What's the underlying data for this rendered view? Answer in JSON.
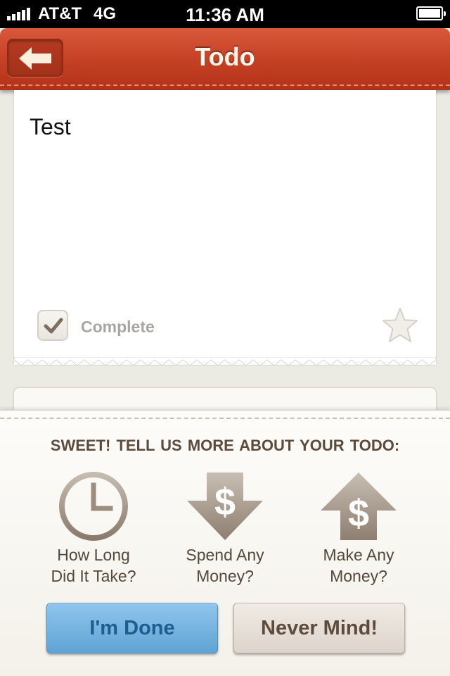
{
  "status_bar": {
    "carrier": "AT&T",
    "network": "4G",
    "time": "11:36 AM",
    "signal_icon": "signal-bars-icon",
    "battery_icon": "battery-full-icon"
  },
  "nav": {
    "title": "Todo",
    "back_icon": "back-arrow-icon",
    "color": "#c43f23"
  },
  "todo": {
    "text": "Test",
    "complete_label": "Complete",
    "complete_checked": true,
    "star_icon": "star-icon",
    "starred": false
  },
  "panel": {
    "heading": "SWEET!  TELL US MORE ABOUT YOUR TODO:",
    "options": [
      {
        "line1": "How Long",
        "line2": "Did It Take?",
        "icon": "clock-icon"
      },
      {
        "line1": "Spend Any",
        "line2": "Money?",
        "icon": "dollar-down-arrow-icon"
      },
      {
        "line1": "Make Any",
        "line2": "Money?",
        "icon": "dollar-up-arrow-icon"
      }
    ],
    "done_label": "I'm Done",
    "nevermind_label": "Never Mind!"
  },
  "colors": {
    "done_button": "#6fb0dd",
    "nevermind_button": "#e6ddd4",
    "heading_text": "#5c4b3d"
  }
}
